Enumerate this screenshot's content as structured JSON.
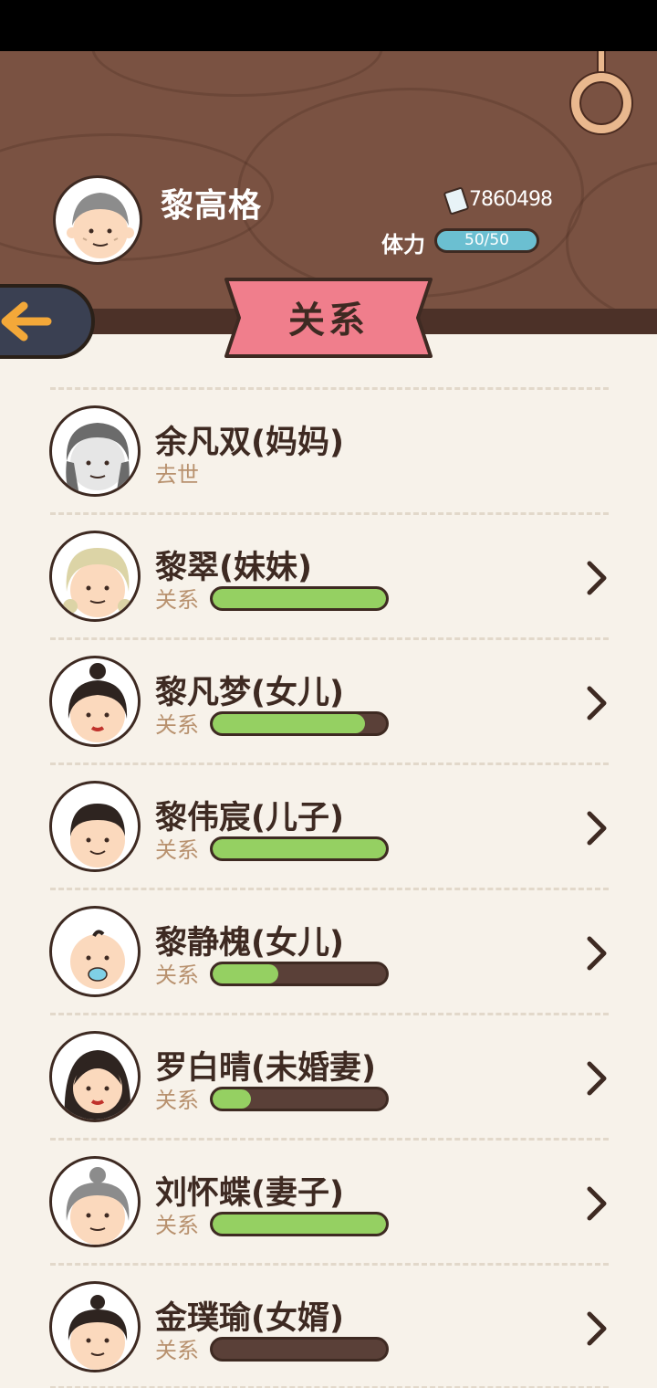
{
  "player": {
    "name": "黎高格",
    "money": "7860498",
    "stamina_label": "体力",
    "stamina_text": "50/50",
    "stamina_fraction": 1.0
  },
  "page": {
    "title": "关系"
  },
  "relations": [
    {
      "name": "余凡双(妈妈)",
      "status": "去世",
      "relation_label": "",
      "level": null,
      "deceased": true,
      "avatar": "grandma-gray"
    },
    {
      "name": "黎翠(妹妹)",
      "status": "",
      "relation_label": "关系",
      "level": 1.0,
      "deceased": false,
      "avatar": "old-woman-blonde"
    },
    {
      "name": "黎凡梦(女儿)",
      "status": "",
      "relation_label": "关系",
      "level": 0.88,
      "deceased": false,
      "avatar": "woman-bun"
    },
    {
      "name": "黎伟宸(儿子)",
      "status": "",
      "relation_label": "关系",
      "level": 1.0,
      "deceased": false,
      "avatar": "young-man"
    },
    {
      "name": "黎静槐(女儿)",
      "status": "",
      "relation_label": "关系",
      "level": 0.38,
      "deceased": false,
      "avatar": "baby-pacifier"
    },
    {
      "name": "罗白晴(未婚妻)",
      "status": "",
      "relation_label": "关系",
      "level": 0.22,
      "deceased": false,
      "avatar": "woman-long-hair"
    },
    {
      "name": "刘怀蝶(妻子)",
      "status": "",
      "relation_label": "关系",
      "level": 1.0,
      "deceased": false,
      "avatar": "old-woman-gray-bun"
    },
    {
      "name": "金璞瑜(女婿)",
      "status": "",
      "relation_label": "关系",
      "level": 0.0,
      "deceased": false,
      "avatar": "man-topknot"
    }
  ],
  "colors": {
    "header_wood": "#7a5242",
    "ribbon": "#f07e8c",
    "bar_fill": "#95d062",
    "stamina": "#6bbfd1",
    "back_button": "#3a4052"
  }
}
